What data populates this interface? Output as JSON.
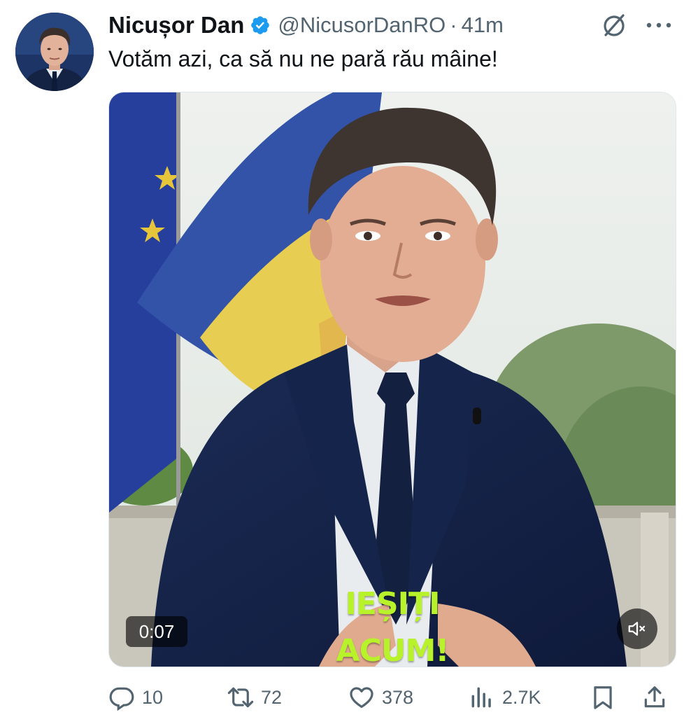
{
  "author": {
    "name": "Nicușor Dan",
    "handle": "@NicusorDanRO",
    "separator": "·",
    "time": "41m",
    "verified": true
  },
  "tweet": {
    "text": "Votăm azi, ca să nu ne pară rău mâine!"
  },
  "video": {
    "caption_line1": "IEȘIȚI",
    "caption_line2": "ACUM!",
    "timecode": "0:07",
    "muted": true
  },
  "actions": {
    "replies": "10",
    "reposts": "72",
    "likes": "378",
    "views": "2.7K"
  },
  "colors": {
    "text": "#0f1419",
    "secondary": "#536471",
    "verified": "#1d9bf0",
    "caption": "#b8f22a"
  }
}
